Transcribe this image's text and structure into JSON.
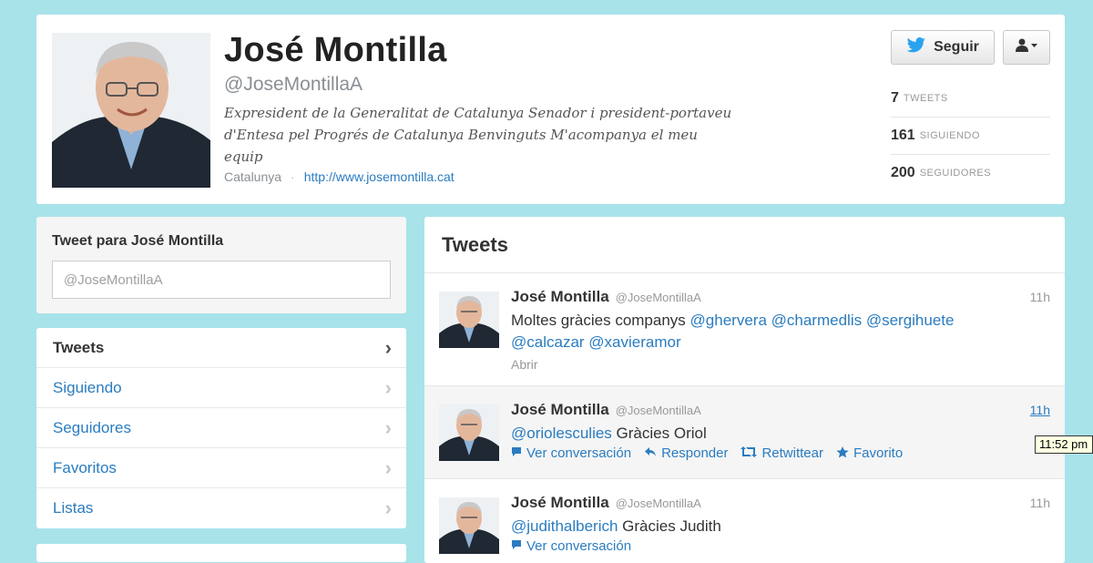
{
  "profile": {
    "name": "José Montilla",
    "handle": "@JoseMontillaA",
    "bio": "Expresident de la Generalitat de Catalunya Senador i president-portaveu d'Entesa pel Progrés de Catalunya Benvinguts M'acompanya el meu equip",
    "location": "Catalunya",
    "separator": "·",
    "url": "http://www.josemontilla.cat"
  },
  "actions": {
    "follow_label": "Seguir",
    "follow_icon": "twitter-bird-icon",
    "user_menu_icon": "user-dropdown-icon"
  },
  "stats": [
    {
      "value": "7",
      "label": "TWEETS"
    },
    {
      "value": "161",
      "label": "SIGUIENDO"
    },
    {
      "value": "200",
      "label": "SEGUIDORES"
    }
  ],
  "compose": {
    "title": "Tweet para José Montilla",
    "placeholder": "@JoseMontillaA"
  },
  "nav": [
    {
      "label": "Tweets",
      "active": true
    },
    {
      "label": "Siguiendo"
    },
    {
      "label": "Seguidores"
    },
    {
      "label": "Favoritos"
    },
    {
      "label": "Listas"
    }
  ],
  "timeline": {
    "title": "Tweets",
    "tweets": [
      {
        "name": "José Montilla",
        "handle": "@JoseMontillaA",
        "time": "11h",
        "text_plain": "Moltes gràcies companys",
        "mentions": [
          "@ghervera",
          "@charmedlis",
          "@sergihuete",
          "@calcazar",
          "@xavieramor"
        ],
        "expand": "Abrir"
      },
      {
        "name": "José Montilla",
        "handle": "@JoseMontillaA",
        "time": "11h",
        "mention": "@oriolesculies",
        "text_plain": "Gràcies Oriol",
        "actions": [
          "Ver conversación",
          "Responder",
          "Retwittear",
          "Favorito"
        ]
      },
      {
        "name": "José Montilla",
        "handle": "@JoseMontillaA",
        "time": "11h",
        "mention": "@judithalberich",
        "text_plain": "Gràcies Judith",
        "actions": [
          "Ver conversación"
        ]
      }
    ]
  },
  "tooltip": "11:52 pm"
}
